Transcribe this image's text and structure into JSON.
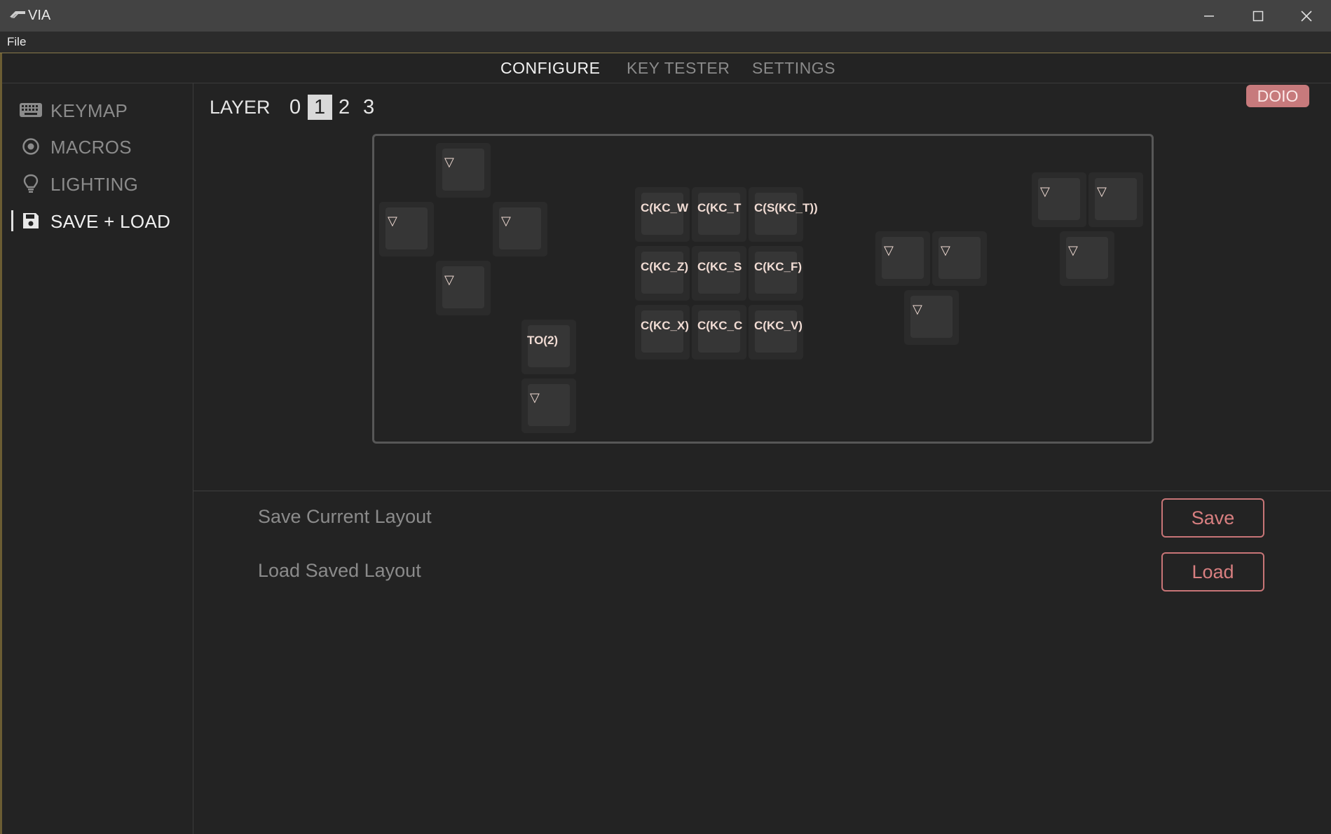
{
  "window": {
    "title": "VIA",
    "min_glyph": "—",
    "close_glyph": "✕"
  },
  "menubar": {
    "file": "File"
  },
  "topnav": {
    "tabs": [
      "CONFIGURE",
      "KEY TESTER",
      "SETTINGS"
    ],
    "active": "CONFIGURE"
  },
  "sidebar": {
    "items": [
      {
        "label": "KEYMAP",
        "icon": "keyboard-icon"
      },
      {
        "label": "MACROS",
        "icon": "circle-dot-icon"
      },
      {
        "label": "LIGHTING",
        "icon": "lightbulb-icon"
      },
      {
        "label": "SAVE + LOAD",
        "icon": "floppy-disk-icon",
        "active": true
      }
    ]
  },
  "layers": {
    "label": "LAYER",
    "numbers": [
      "0",
      "1",
      "2",
      "3"
    ],
    "selected": "1"
  },
  "brand_badge": "DOIO",
  "keys": {
    "dpad_up": "▽",
    "dpad_left": "▽",
    "dpad_right": "▽",
    "dpad_down": "▽",
    "to2": "TO(2)",
    "below_to2": "▽",
    "g1": "C(KC_W",
    "g2": "C(KC_T",
    "g3": "C(S(KC_T))",
    "g4": "C(KC_Z)",
    "g5": "C(KC_S",
    "g6": "C(KC_F)",
    "g7": "C(KC_X)",
    "g8": "C(KC_C",
    "g9": "C(KC_V)",
    "mid1": "▽",
    "mid2": "▽",
    "mid3": "▽",
    "right1": "▽",
    "right2": "▽",
    "right3": "▽"
  },
  "save_load": {
    "save_label": "Save Current Layout",
    "load_label": "Load Saved Layout",
    "save_button": "Save",
    "load_button": "Load"
  },
  "colors": {
    "accent": "#c77a7c",
    "background": "#232323",
    "titlebar": "#434343"
  }
}
